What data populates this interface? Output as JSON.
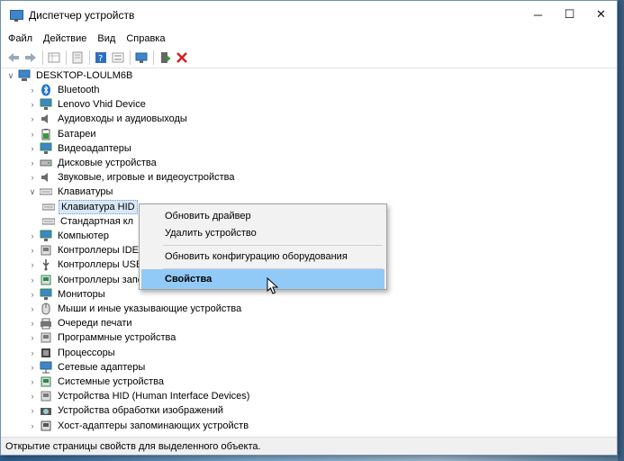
{
  "window": {
    "title": "Диспетчер устройств",
    "controls": [
      "─",
      "☐",
      "✕"
    ]
  },
  "menu": [
    "Файл",
    "Действие",
    "Вид",
    "Справка"
  ],
  "toolbar": {
    "icons": [
      "back-arrow-icon",
      "forward-arrow-icon",
      "properties-grid-icon",
      "update-driver-icon",
      "help-icon",
      "show-hidden-icon",
      "scan-hardware-icon",
      "add-driver-icon",
      "remove-device-icon"
    ]
  },
  "tree": {
    "root": "DESKTOP-LOULM6B",
    "items": [
      {
        "label": "Bluetooth",
        "icon": "bluetooth-icon",
        "color": "#1a6fd1"
      },
      {
        "label": "Lenovo Vhid Device",
        "icon": "monitor-icon",
        "color": "#2d8a4e"
      },
      {
        "label": "Аудиовходы и аудиовыходы",
        "icon": "speaker-icon",
        "color": "#6b6b6b"
      },
      {
        "label": "Батареи",
        "icon": "battery-icon",
        "color": "#3a9a3a"
      },
      {
        "label": "Видеоадаптеры",
        "icon": "display-adapter-icon",
        "color": "#2d8a4e"
      },
      {
        "label": "Дисковые устройства",
        "icon": "disk-icon",
        "color": "#777777"
      },
      {
        "label": "Звуковые, игровые и видеоустройства",
        "icon": "speaker-icon",
        "color": "#6b6b6b"
      },
      {
        "label": "Клавиатуры",
        "icon": "keyboard-icon",
        "color": "#8a8a8a",
        "expanded": true
      },
      {
        "label": "Клавиатура HID",
        "icon": "keyboard-icon",
        "color": "#8a8a8a",
        "child": true,
        "selected": true
      },
      {
        "label": "Стандартная кл",
        "icon": "keyboard-icon",
        "color": "#8a8a8a",
        "child": true
      },
      {
        "label": "Компьютер",
        "icon": "computer-icon",
        "color": "#2d8a4e"
      },
      {
        "label": "Контроллеры IDE A",
        "icon": "ide-controller-icon",
        "color": "#777777"
      },
      {
        "label": "Контроллеры USB",
        "icon": "usb-icon",
        "color": "#555555"
      },
      {
        "label": "Контроллеры запо",
        "icon": "storage-controller-icon",
        "color": "#2d8a4e"
      },
      {
        "label": "Мониторы",
        "icon": "monitor-icon",
        "color": "#2d8a4e"
      },
      {
        "label": "Мыши и иные указывающие устройства",
        "icon": "mouse-icon",
        "color": "#8a8a8a"
      },
      {
        "label": "Очереди печати",
        "icon": "printer-icon",
        "color": "#555555"
      },
      {
        "label": "Программные устройства",
        "icon": "software-device-icon",
        "color": "#777777"
      },
      {
        "label": "Процессоры",
        "icon": "processor-icon",
        "color": "#555555"
      },
      {
        "label": "Сетевые адаптеры",
        "icon": "network-icon",
        "color": "#2d8a4e"
      },
      {
        "label": "Системные устройства",
        "icon": "system-device-icon",
        "color": "#2d8a4e"
      },
      {
        "label": "Устройства HID (Human Interface Devices)",
        "icon": "hid-icon",
        "color": "#777777"
      },
      {
        "label": "Устройства обработки изображений",
        "icon": "camera-icon",
        "color": "#555555"
      },
      {
        "label": "Хост-адаптеры запоминающих устройств",
        "icon": "storage-host-icon",
        "color": "#555555"
      }
    ]
  },
  "context_menu": {
    "items": [
      {
        "label": "Обновить драйвер"
      },
      {
        "label": "Удалить устройство"
      },
      {
        "label": "Обновить конфигурацию оборудования"
      },
      {
        "label": "Свойства",
        "highlighted": true
      }
    ]
  },
  "statusbar": {
    "text": "Открытие страницы свойств для выделенного объекта."
  },
  "colors": {
    "selection": "#d9e8f7",
    "menu_highlight": "#91c9f7",
    "accent": "#1a6fd1"
  }
}
